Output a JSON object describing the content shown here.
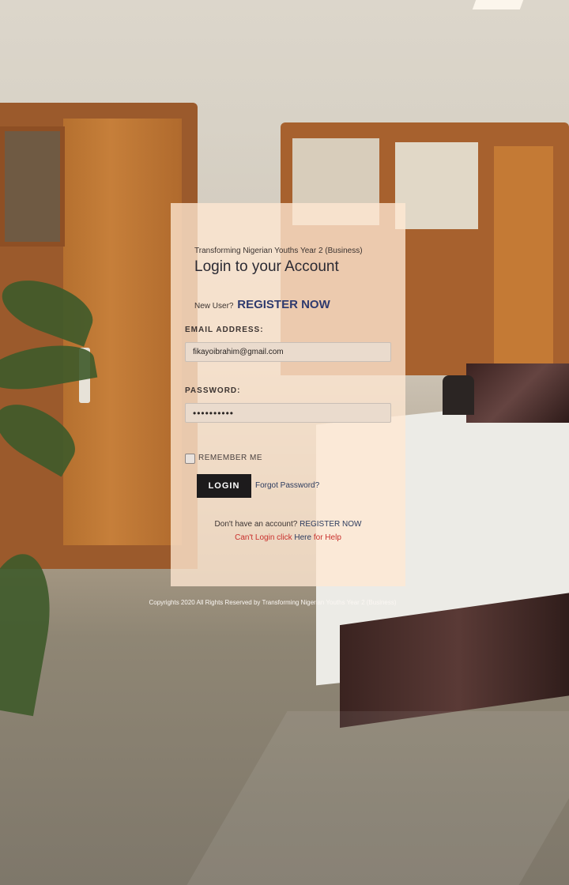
{
  "header": {
    "subtitle": "Transforming Nigerian Youths Year 2 (Business)",
    "title": "Login to your Account"
  },
  "new_user": {
    "prompt": "New User?",
    "register_link": "REGISTER NOW"
  },
  "form": {
    "email_label": "EMAIL ADDRESS:",
    "email_value": "fikayoibrahim@gmail.com",
    "password_label": "PASSWORD:",
    "password_value": "••••••••••",
    "remember_label": "REMEMBER ME",
    "login_button": "LOGIN",
    "forgot_link": "Forgot Password?"
  },
  "footer": {
    "no_account": "Don't have an account?",
    "register_link": "REGISTER NOW",
    "cant_login": "Can't Login click",
    "here_link": "Here",
    "for_help": "for Help"
  },
  "copyright": "Copyrights 2020 All Rights Reserved by Transforming Nigerian Youths Year 2 (Business)"
}
